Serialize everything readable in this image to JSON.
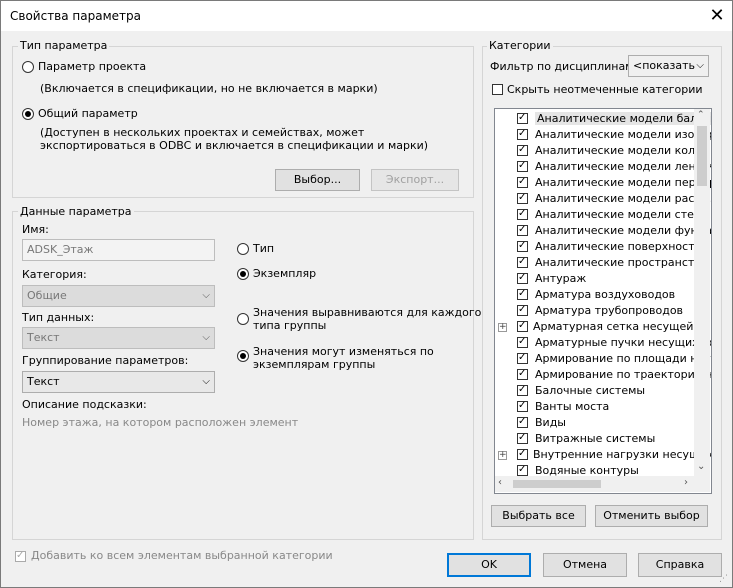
{
  "window": {
    "title": "Свойства параметра"
  },
  "param_type": {
    "group_title": "Тип параметра",
    "project_label": "Параметр проекта",
    "project_desc": "(Включается в спецификации, но не включается в марки)",
    "shared_label": "Общий параметр",
    "shared_desc_line1": "(Доступен в нескольких проектах и семействах, может",
    "shared_desc_line2": "экспортироваться в ODBC и включается в спецификации и марки)",
    "select_button": "Выбор...",
    "export_button": "Экспорт..."
  },
  "param_data": {
    "group_title": "Данные параметра",
    "name_label": "Имя:",
    "name_value": "ADSK_Этаж",
    "category_label": "Категория:",
    "category_value": "Общие",
    "datatype_label": "Тип данных:",
    "datatype_value": "Текст",
    "grouping_label": "Группирование параметров:",
    "grouping_value": "Текст",
    "tooltip_label": "Описание подсказки:",
    "tooltip_value": "Номер этажа, на котором расположен элемент",
    "type_label": "Тип",
    "instance_label": "Экземпляр",
    "aligned_line1": "Значения выравниваются для каждого",
    "aligned_line2": "типа группы",
    "vary_line1": "Значения могут изменяться по",
    "vary_line2": "экземплярам группы"
  },
  "categories": {
    "group_title": "Категории",
    "filter_label": "Фильтр по дисциплинам:",
    "filter_value": "<показать",
    "hide_unchecked": "Скрыть неотмеченные категории",
    "items": [
      {
        "label": "Аналитические модели балки",
        "checked": true,
        "expander": false
      },
      {
        "label": "Аналитические модели изолир",
        "checked": true,
        "expander": false
      },
      {
        "label": "Аналитические модели кол...",
        "checked": true,
        "expander": false
      },
      {
        "label": "Аналитические модели ленточ",
        "checked": true,
        "expander": false
      },
      {
        "label": "Аналитические модели перекр",
        "checked": true,
        "expander": false
      },
      {
        "label": "Аналитические модели раско...",
        "checked": true,
        "expander": false
      },
      {
        "label": "Аналитические модели стен",
        "checked": true,
        "expander": false
      },
      {
        "label": "Аналитические модели фундам",
        "checked": true,
        "expander": false
      },
      {
        "label": "Аналитические поверхности",
        "checked": true,
        "expander": false
      },
      {
        "label": "Аналитические пространства",
        "checked": true,
        "expander": false
      },
      {
        "label": "Антураж",
        "checked": true,
        "expander": false
      },
      {
        "label": "Арматура воздуховодов",
        "checked": true,
        "expander": false
      },
      {
        "label": "Арматура трубопроводов",
        "checked": true,
        "expander": false
      },
      {
        "label": "Арматурная сетка несущей ко",
        "checked": true,
        "expander": true
      },
      {
        "label": "Арматурные пучки несущих ко",
        "checked": true,
        "expander": false
      },
      {
        "label": "Армирование по площади несу",
        "checked": true,
        "expander": false
      },
      {
        "label": "Армирование по траектории не",
        "checked": true,
        "expander": false
      },
      {
        "label": "Балочные системы",
        "checked": true,
        "expander": false
      },
      {
        "label": "Ванты моста",
        "checked": true,
        "expander": false
      },
      {
        "label": "Виды",
        "checked": true,
        "expander": false
      },
      {
        "label": "Витражные системы",
        "checked": true,
        "expander": false
      },
      {
        "label": "Внутренние нагрузки несущих ко",
        "checked": true,
        "expander": true
      },
      {
        "label": "Водяные контуры",
        "checked": true,
        "expander": false
      }
    ],
    "select_all": "Выбрать все",
    "deselect_all": "Отменить выбор"
  },
  "footer": {
    "add_to_all": "Добавить ко всем элементам выбранной категории",
    "ok": "OK",
    "cancel": "Отмена",
    "help": "Справка"
  }
}
